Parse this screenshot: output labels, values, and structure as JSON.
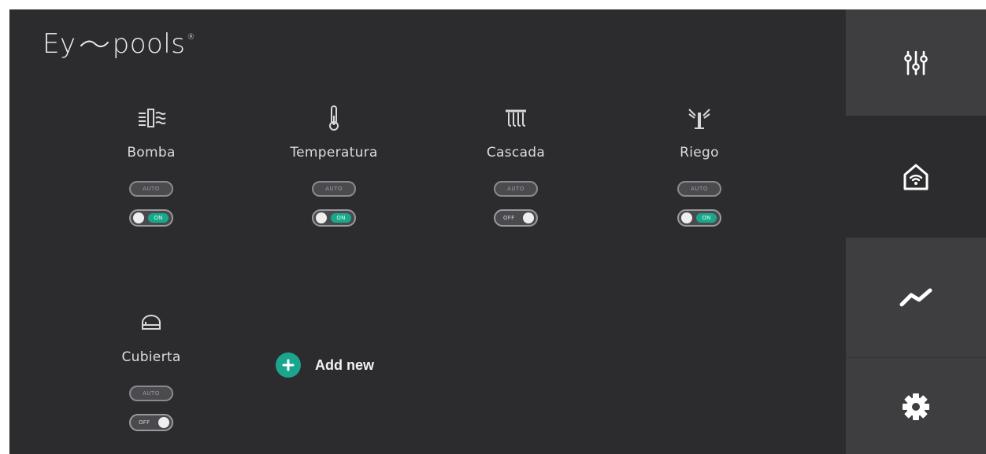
{
  "app": {
    "logo_text_left": "Ey",
    "logo_text_right": "pools",
    "logo_reg": "®"
  },
  "devices": [
    {
      "name": "Bomba",
      "icon": "pump-icon",
      "auto_label": "AUTO",
      "state": "ON"
    },
    {
      "name": "Temperatura",
      "icon": "thermometer-icon",
      "auto_label": "AUTO",
      "state": "ON"
    },
    {
      "name": "Cascada",
      "icon": "waterfall-icon",
      "auto_label": "AUTO",
      "state": "OFF"
    },
    {
      "name": "Riego",
      "icon": "sprinkler-icon",
      "auto_label": "AUTO",
      "state": "ON"
    },
    {
      "name": "Cubierta",
      "icon": "pool-cover-icon",
      "auto_label": "AUTO",
      "state": "OFF"
    }
  ],
  "add_new": {
    "label": "Add new",
    "icon": "plus-icon"
  },
  "sidebar": {
    "items": [
      {
        "name": "controls",
        "icon": "sliders-icon"
      },
      {
        "name": "home",
        "icon": "smart-home-icon",
        "active": true
      },
      {
        "name": "stats",
        "icon": "trend-icon"
      },
      {
        "name": "settings",
        "icon": "gear-icon"
      }
    ]
  },
  "colors": {
    "background": "#2c2b2d",
    "sidebar": "#3e3d40",
    "accent": "#1aa58c",
    "text": "#dcdcdc"
  }
}
